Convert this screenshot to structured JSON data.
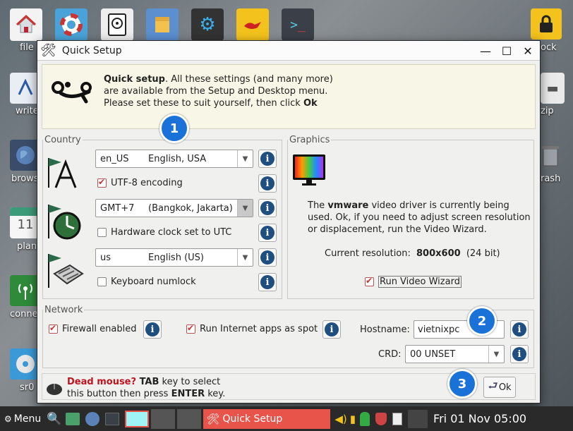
{
  "desktop": {
    "labels_left": [
      "file",
      "write",
      "brows",
      "plan",
      "conne",
      "sr0"
    ],
    "labels_right": [
      "ock",
      "zip",
      "rash"
    ],
    "calendar_day": "11"
  },
  "window": {
    "title": "Quick Setup",
    "intro": {
      "bold": "Quick setup",
      "text": ". All these settings (and many more) are available from the Setup and Desktop menu. Please set these to suit yourself, then click ",
      "ok_word": "Ok"
    },
    "country": {
      "legend": "Country",
      "locale_code": "en_US",
      "locale_name": "English, USA",
      "utf8_label": "UTF-8 encoding",
      "timezone_code": "GMT+7",
      "timezone_name": "(Bangkok, Jakarta)",
      "hwclock_label": "Hardware clock set to UTC",
      "keyboard_code": "us",
      "keyboard_name": "English (US)",
      "numlock_label": "Keyboard numlock"
    },
    "graphics": {
      "legend": "Graphics",
      "desc_pre": "The ",
      "driver": "vmware",
      "desc_post": " video driver is currently being used. Ok, if you need to adjust screen resolution or displacement, run the Video Wizard.",
      "res_label": "Current resolution:",
      "res_value": "800x600",
      "res_bits": "(24 bit)",
      "wizard_label": "Run Video Wizard"
    },
    "network": {
      "legend": "Network",
      "firewall_label": "Firewall enabled",
      "spot_label": "Run Internet apps as spot",
      "hostname_label": "Hostname:",
      "hostname_value": "vietnixpc",
      "crd_label": "CRD:",
      "crd_value": "00 UNSET"
    },
    "footer": {
      "dead_bold": "Dead mouse?",
      "dead_tab": " TAB",
      "dead_mid": " key to select this button then press ",
      "dead_enter": "ENTER",
      "dead_end": " key.",
      "ok_label": "Ok"
    },
    "badges": [
      "1",
      "2",
      "3"
    ]
  },
  "taskbar": {
    "menu_label": "Menu",
    "task_label": "Quick Setup",
    "clock": "Fri 01 Nov 05:00"
  },
  "colors": {
    "badge": "#1a72d8",
    "active_task": "#e8544a",
    "check": "#cc3333"
  }
}
